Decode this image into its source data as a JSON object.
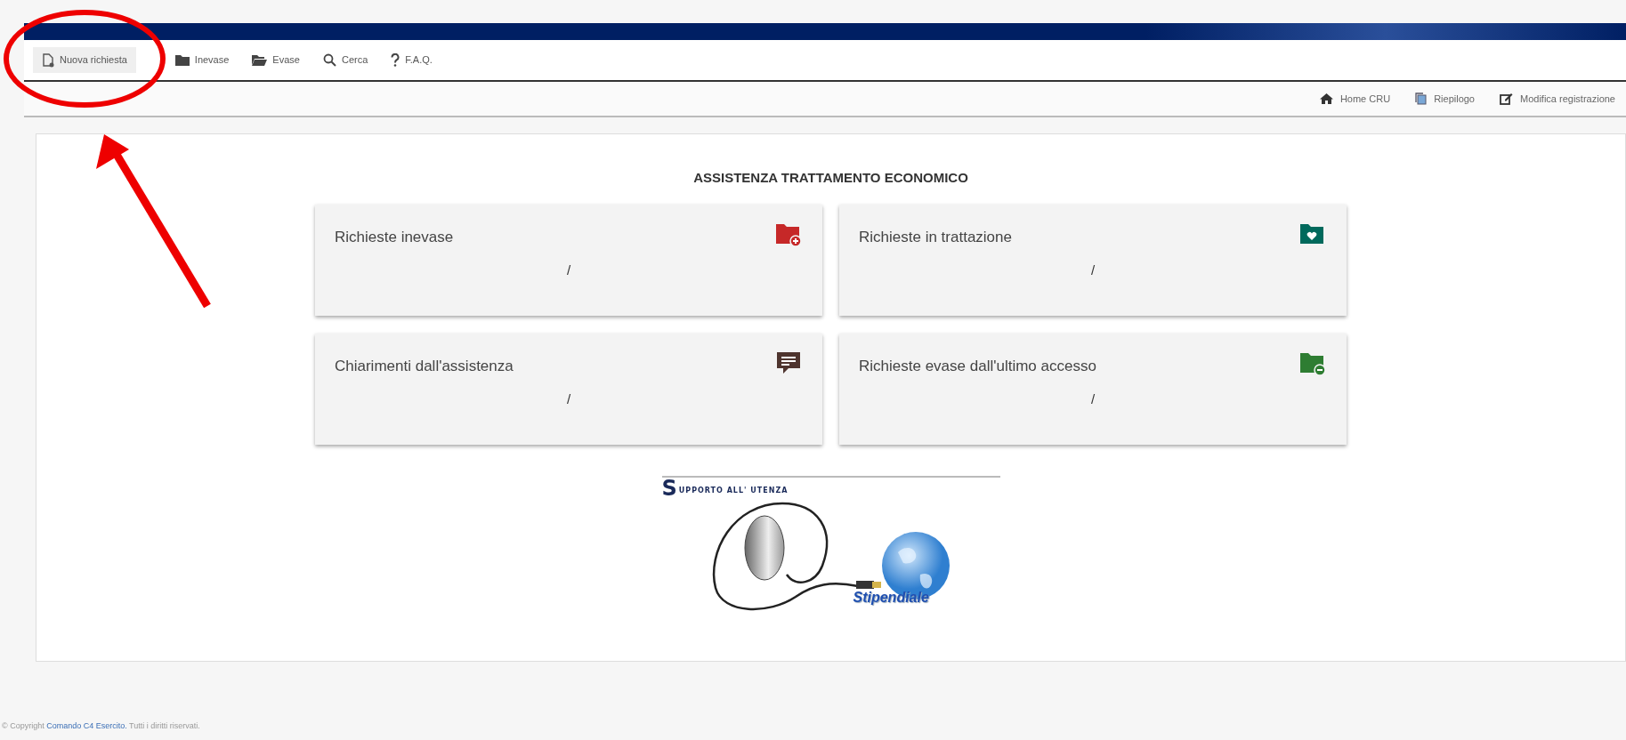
{
  "menu": [
    {
      "label": "Nuova richiesta",
      "kind": "newdoc",
      "selected": true
    },
    {
      "label": "Inevase",
      "kind": "folder",
      "selected": false
    },
    {
      "label": "Evase",
      "kind": "openfolder",
      "selected": false
    },
    {
      "label": "Cerca",
      "kind": "search",
      "selected": false
    },
    {
      "label": "F.A.Q.",
      "kind": "question",
      "selected": false
    }
  ],
  "user_links": [
    {
      "label": "Home CRU",
      "kind": "home"
    },
    {
      "label": "Riepilogo",
      "kind": "copy"
    },
    {
      "label": "Modifica registrazione",
      "kind": "edit"
    }
  ],
  "title": "ASSISTENZA TRATTAMENTO ECONOMICO",
  "cards": [
    {
      "label": "Richieste inevase",
      "value": "/",
      "kind": "folderplus",
      "color": "#c62828"
    },
    {
      "label": "Richieste in trattazione",
      "value": "/",
      "kind": "folderheart",
      "color": "#00695c"
    },
    {
      "label": "Chiarimenti dall'assistenza",
      "value": "/",
      "kind": "comment",
      "color": "#4e342e"
    },
    {
      "label": "Richieste evase dall'ultimo accesso",
      "value": "/",
      "kind": "folderminus",
      "color": "#2e7d32"
    }
  ],
  "logo": {
    "heading_initial": "S",
    "heading_rest": "UPPORTO ALL' UTENZA",
    "caption": "Stipendiale"
  },
  "footer": {
    "prefix": "© Copyright",
    "link": "Comando C4 Esercito.",
    "suffix": "Tutti i diritti riservati."
  }
}
